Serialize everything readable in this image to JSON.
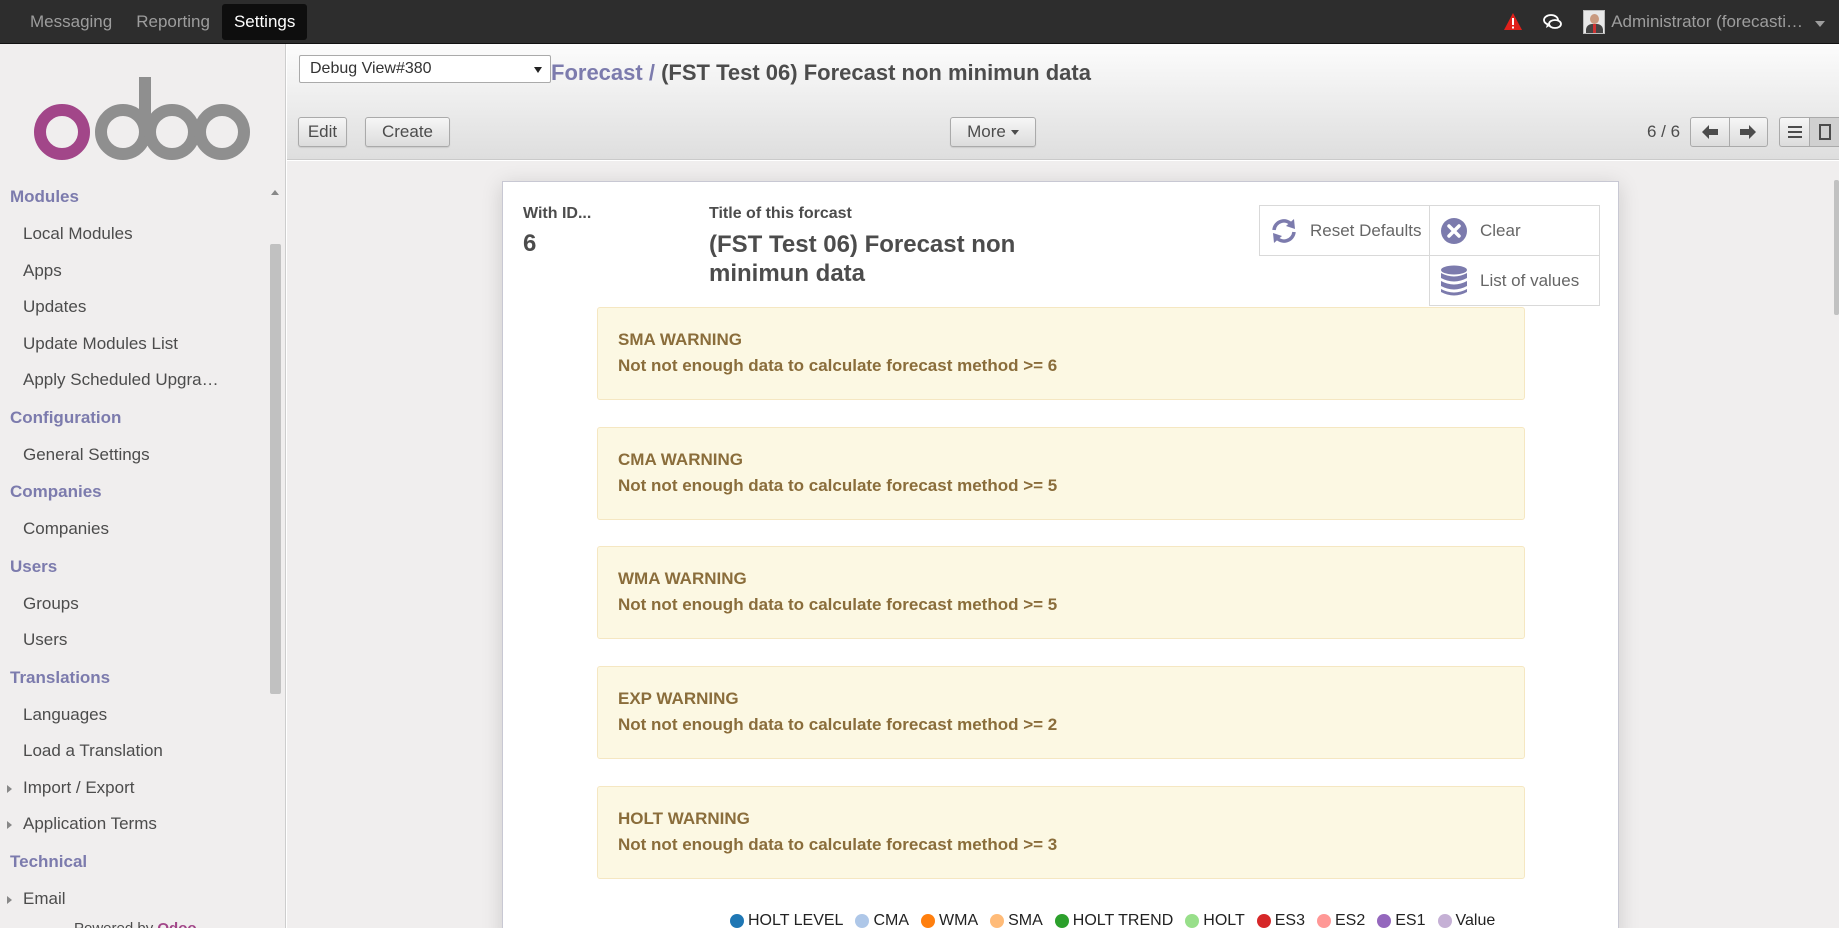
{
  "topbar": {
    "menu": [
      {
        "label": "Messaging"
      },
      {
        "label": "Reporting"
      },
      {
        "label": "Settings"
      }
    ],
    "user_name": "Administrator (forecasti…"
  },
  "sidebar": {
    "logo_text": "odoo",
    "sections": [
      {
        "title": "Modules",
        "items": [
          {
            "label": "Local Modules"
          },
          {
            "label": "Apps"
          },
          {
            "label": "Updates"
          },
          {
            "label": "Update Modules List"
          },
          {
            "label": "Apply Scheduled Upgra…"
          }
        ]
      },
      {
        "title": "Configuration",
        "items": [
          {
            "label": "General Settings"
          }
        ]
      },
      {
        "title": "Companies",
        "items": [
          {
            "label": "Companies"
          }
        ]
      },
      {
        "title": "Users",
        "items": [
          {
            "label": "Groups"
          },
          {
            "label": "Users"
          }
        ]
      },
      {
        "title": "Translations",
        "items": [
          {
            "label": "Languages"
          },
          {
            "label": "Load a Translation"
          },
          {
            "label": "Import / Export"
          },
          {
            "label": "Application Terms"
          }
        ]
      },
      {
        "title": "Technical",
        "items": [
          {
            "label": "Email"
          }
        ]
      }
    ],
    "powered_by": "Powered by",
    "powered_brand": "Odoo"
  },
  "control_panel": {
    "debug_select": "Debug View#380",
    "breadcrumb_parent": "Forecast",
    "breadcrumb_sep": "/",
    "breadcrumb_current": "(FST Test 06) Forecast non minimun data",
    "edit_label": "Edit",
    "create_label": "Create",
    "more_label": "More",
    "pager": "6 / 6"
  },
  "form": {
    "id_label": "With ID...",
    "id_value": "6",
    "title_label": "Title of this forcast",
    "title_value": "(FST Test 06) Forecast non minimun data",
    "reset_label": "Reset Defaults",
    "clear_label": "Clear",
    "list_label": "List of values",
    "warnings": [
      {
        "title": "SMA WARNING",
        "message": "Not not enough data to calculate forecast method >= 6"
      },
      {
        "title": "CMA WARNING",
        "message": "Not not enough data to calculate forecast method >= 5"
      },
      {
        "title": "WMA WARNING",
        "message": "Not not enough data to calculate forecast method >= 5"
      },
      {
        "title": "EXP WARNING",
        "message": "Not not enough data to calculate forecast method >= 2"
      },
      {
        "title": "HOLT WARNING",
        "message": "Not not enough data to calculate forecast method >= 3"
      }
    ],
    "legend": [
      {
        "label": "HOLT LEVEL",
        "color": "#1f77b4"
      },
      {
        "label": "CMA",
        "color": "#aec7e8"
      },
      {
        "label": "WMA",
        "color": "#ff7f0e"
      },
      {
        "label": "SMA",
        "color": "#ffbb78"
      },
      {
        "label": "HOLT TREND",
        "color": "#2ca02c"
      },
      {
        "label": "HOLT",
        "color": "#98df8a"
      },
      {
        "label": "ES3",
        "color": "#d62728"
      },
      {
        "label": "ES2",
        "color": "#ff9896"
      },
      {
        "label": "ES1",
        "color": "#9467bd"
      },
      {
        "label": "Value",
        "color": "#c5b0d5"
      }
    ]
  },
  "colors": {
    "accent": "#7c7bad",
    "topbar": "#2d2d2d",
    "warning_bg": "#fcf8e3",
    "warning_text": "#8a6d3b"
  }
}
